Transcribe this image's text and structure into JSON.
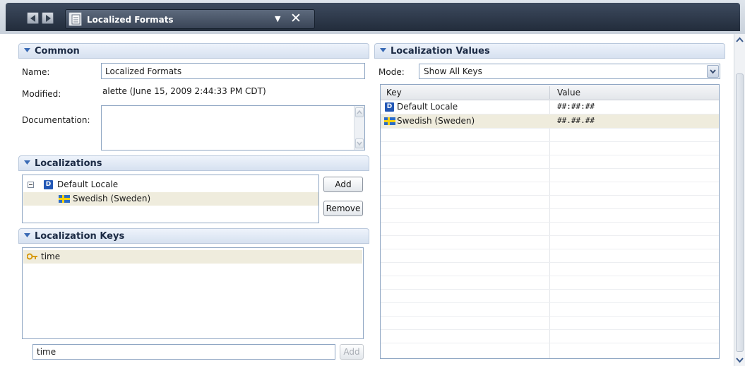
{
  "window": {
    "tab_title": "Localized Formats"
  },
  "common": {
    "header": "Common",
    "name_label": "Name:",
    "name_value": "Localized Formats",
    "modified_label": "Modified:",
    "modified_value": "alette (June 15, 2009 2:44:33 PM CDT)",
    "documentation_label": "Documentation:",
    "documentation_value": ""
  },
  "localizations": {
    "header": "Localizations",
    "tree": [
      {
        "label": "Default Locale",
        "icon": "default-locale-icon",
        "expanded": true
      },
      {
        "label": "Swedish (Sweden)",
        "icon": "swedish-flag-icon",
        "selected": true
      }
    ],
    "add_label": "Add",
    "remove_label": "Remove"
  },
  "keys": {
    "header": "Localization Keys",
    "items": [
      {
        "label": "time",
        "icon": "key-icon",
        "selected": true
      }
    ],
    "new_key_value": "time",
    "add_label": "Add"
  },
  "values": {
    "header": "Localization Values",
    "mode_label": "Mode:",
    "mode_value": "Show All Keys",
    "columns": [
      "Key",
      "Value"
    ],
    "rows": [
      {
        "key": "Default Locale",
        "icon": "default-locale-icon",
        "value": "##:##:##"
      },
      {
        "key": "Swedish (Sweden)",
        "icon": "swedish-flag-icon",
        "value": "##.##.##",
        "selected": true
      }
    ]
  },
  "colors": {
    "section_header": "#d6e1f0",
    "selected_row": "#efecdd",
    "title_bar": "#2a3445"
  }
}
